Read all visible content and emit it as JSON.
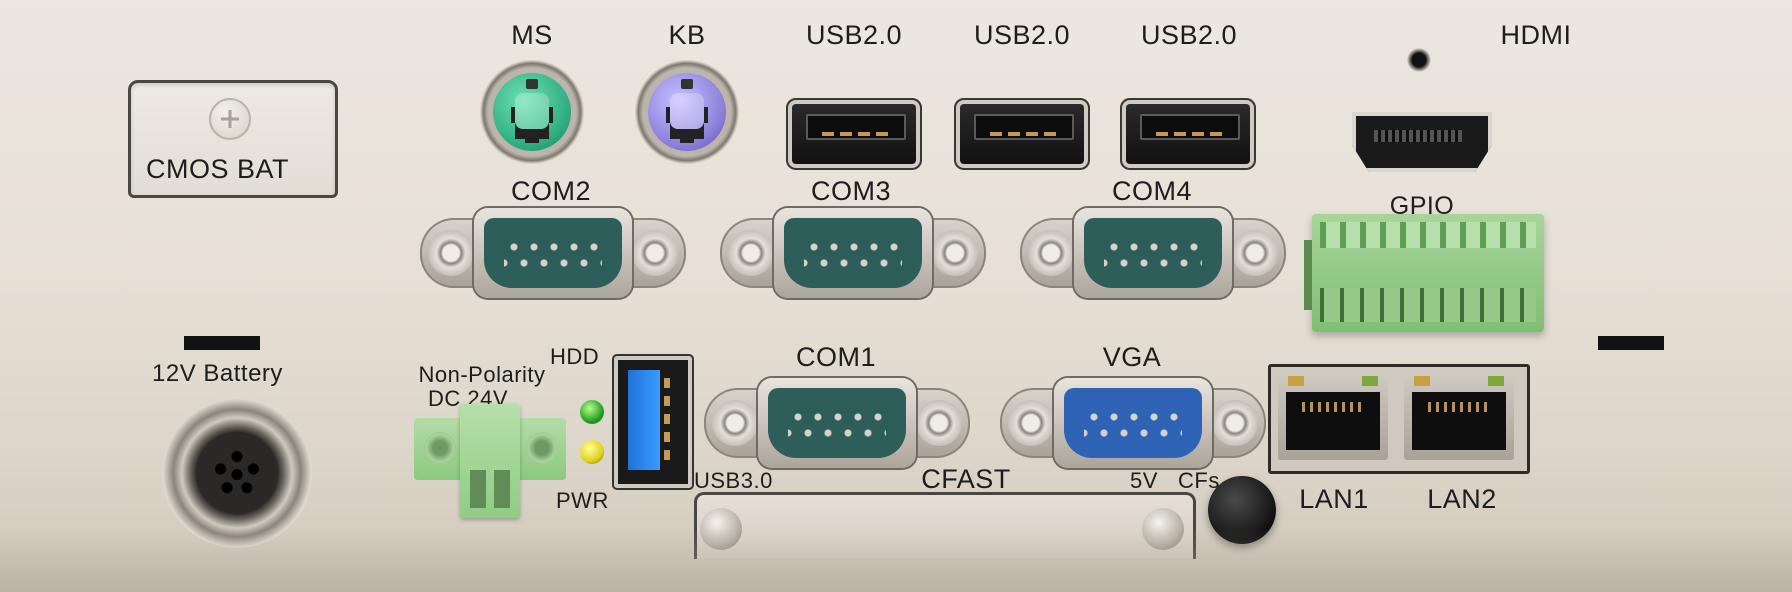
{
  "labels": {
    "cmos_bat": "CMOS  BAT",
    "ms": "MS",
    "kb": "KB",
    "usb2_1": "USB2.0",
    "usb2_2": "USB2.0",
    "usb2_3": "USB2.0",
    "hdmi": "HDMI",
    "com2": "COM2",
    "com3": "COM3",
    "com4": "COM4",
    "gpio": "GPIO",
    "battery_12v": "12V  Battery",
    "non_polarity": "Non-Polarity",
    "dc_24v": "DC  24V",
    "hdd": "HDD",
    "pwr": "PWR",
    "com1": "COM1",
    "vga": "VGA",
    "usb3": "USB3.0",
    "cfast": "CFAST",
    "v5": "5V",
    "cfs": "CFs",
    "lan1": "LAN1",
    "lan2": "LAN2"
  },
  "colors": {
    "ms_port": "#3ab88c",
    "kb_port": "#8c7fdb",
    "serial_body": "#2e5e5a",
    "vga_body": "#2f63b5",
    "gpio_block": "#8cc980",
    "usb3_tongue": "#2f86ee",
    "hdd_led": "#2fa52f",
    "pwr_led": "#e1d21a"
  },
  "icons": {
    "cmos_screw": "phillips-screw-icon",
    "power_button": "power-button"
  }
}
